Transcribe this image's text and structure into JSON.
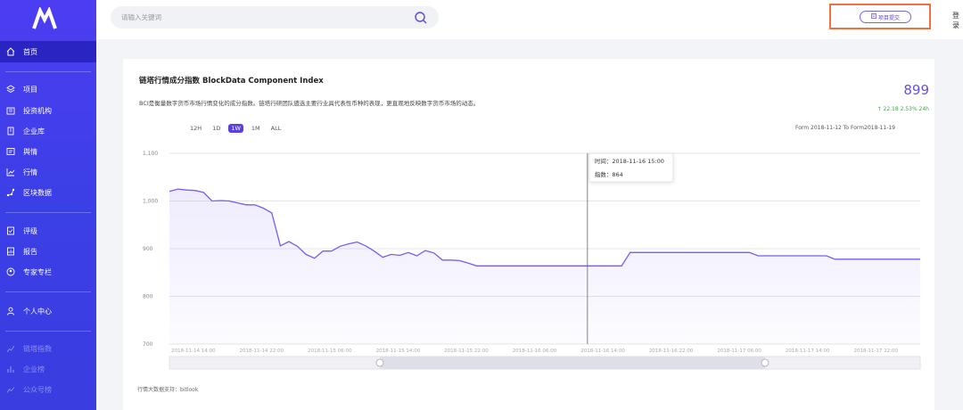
{
  "colors": {
    "sidebar": "#3b3fe6",
    "accent": "#5b3fe0",
    "line": "#7a5cf0",
    "positive": "#3da84a",
    "highlight_border": "#f07040"
  },
  "sidebar": {
    "items": [
      {
        "label": "首页",
        "icon": "home-icon"
      },
      {
        "label": "项目",
        "icon": "layers-icon"
      },
      {
        "label": "投资机构",
        "icon": "institution-icon"
      },
      {
        "label": "企业库",
        "icon": "building-icon"
      },
      {
        "label": "舆情",
        "icon": "news-icon"
      },
      {
        "label": "行情",
        "icon": "trend-icon"
      },
      {
        "label": "区块数据",
        "icon": "blocks-icon"
      },
      {
        "label": "评级",
        "icon": "rating-icon"
      },
      {
        "label": "报告",
        "icon": "report-icon"
      },
      {
        "label": "专家专栏",
        "icon": "expert-icon"
      },
      {
        "label": "个人中心",
        "icon": "user-icon"
      },
      {
        "label": "链塔指数",
        "icon": "index-icon"
      },
      {
        "label": "企业榜",
        "icon": "rank-icon"
      },
      {
        "label": "公众号榜",
        "icon": "wechat-rank-icon"
      }
    ]
  },
  "header": {
    "search_placeholder": "请输入关键词",
    "submit_label": "项目提交",
    "login_label": "登录"
  },
  "card": {
    "title": "链塔行情成分指数 BlockData Component Index",
    "description": "BCI是衡量数字货币市场行情变化的成分指数。链塔行研团队遴选主要行业具代表性币种的表现，更直观地反映数字货币市场的动态。",
    "price": "899",
    "change": "↑ 22.18  2.53%  24h",
    "ranges": [
      "12H",
      "1D",
      "1W",
      "1M",
      "ALL"
    ],
    "selected_range": "1W",
    "date_range": "Form 2018-11-12   To   Form2018-11-19",
    "footnote": "行情大数据支持：bitlook"
  },
  "chart_data": {
    "type": "line",
    "ylim": [
      700,
      1100
    ],
    "yticks": [
      "1,100",
      "1,000",
      "900",
      "800",
      "700"
    ],
    "xticks": [
      "2018-11-14 14:00",
      "2018-11-14 22:00",
      "2018-11-15 06:00",
      "2018-11-15 14:00",
      "2018-11-15 22:00",
      "2018-11-16 06:00",
      "2018-11-16 14:00",
      "2018-11-16 22:00",
      "2018-11-17 06:00",
      "2018-11-17 14:00",
      "2018-11-17 22:00"
    ],
    "x_start": "2018-11-14 14:00",
    "x_end": "2018-11-18 06:00",
    "series": [
      {
        "points": [
          [
            "2018-11-14 14:00",
            1020
          ],
          [
            "2018-11-14 15:00",
            1025
          ],
          [
            "2018-11-14 16:00",
            1023
          ],
          [
            "2018-11-14 17:00",
            1022
          ],
          [
            "2018-11-14 18:00",
            1018
          ],
          [
            "2018-11-14 19:00",
            1000
          ],
          [
            "2018-11-14 20:00",
            1001
          ],
          [
            "2018-11-14 21:00",
            1000
          ],
          [
            "2018-11-14 22:00",
            996
          ],
          [
            "2018-11-14 23:00",
            992
          ],
          [
            "2018-11-15 00:00",
            992
          ],
          [
            "2018-11-15 01:00",
            985
          ],
          [
            "2018-11-15 02:00",
            975
          ],
          [
            "2018-11-15 03:00",
            906
          ],
          [
            "2018-11-15 04:00",
            915
          ],
          [
            "2018-11-15 05:00",
            905
          ],
          [
            "2018-11-15 06:00",
            888
          ],
          [
            "2018-11-15 07:00",
            880
          ],
          [
            "2018-11-15 08:00",
            895
          ],
          [
            "2018-11-15 09:00",
            895
          ],
          [
            "2018-11-15 10:00",
            905
          ],
          [
            "2018-11-15 11:00",
            910
          ],
          [
            "2018-11-15 12:00",
            914
          ],
          [
            "2018-11-15 13:00",
            906
          ],
          [
            "2018-11-15 14:00",
            895
          ],
          [
            "2018-11-15 15:00",
            882
          ],
          [
            "2018-11-15 16:00",
            888
          ],
          [
            "2018-11-15 17:00",
            886
          ],
          [
            "2018-11-15 18:00",
            892
          ],
          [
            "2018-11-15 19:00",
            885
          ],
          [
            "2018-11-15 20:00",
            896
          ],
          [
            "2018-11-15 21:00",
            891
          ],
          [
            "2018-11-15 22:00",
            876
          ],
          [
            "2018-11-15 23:00",
            876
          ],
          [
            "2018-11-16 00:00",
            875
          ],
          [
            "2018-11-16 01:00",
            870
          ],
          [
            "2018-11-16 02:00",
            864
          ],
          [
            "2018-11-16 15:00",
            864
          ],
          [
            "2018-11-16 19:00",
            864
          ],
          [
            "2018-11-16 20:00",
            892
          ],
          [
            "2018-11-16 21:00",
            892
          ],
          [
            "2018-11-17 10:00",
            892
          ],
          [
            "2018-11-17 11:00",
            885
          ],
          [
            "2018-11-17 19:00",
            885
          ],
          [
            "2018-11-17 20:00",
            878
          ],
          [
            "2018-11-18 06:00",
            878
          ]
        ]
      }
    ],
    "tooltip": {
      "time_label": "时间：2018-11-16 15:00",
      "value_label": "指数：864",
      "at": "2018-11-16 15:00"
    }
  }
}
